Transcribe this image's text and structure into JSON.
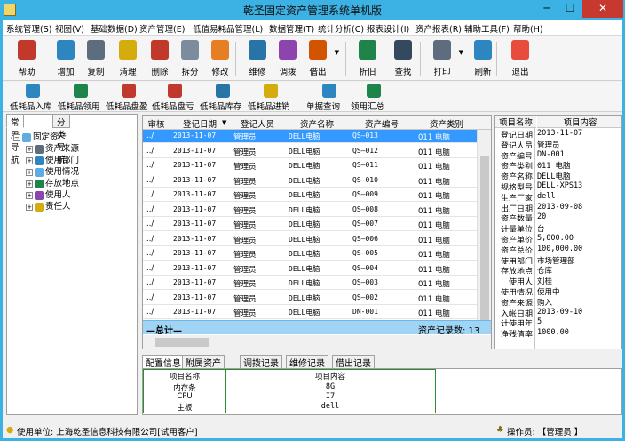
{
  "window": {
    "title": "乾圣固定资产管理系统单机版",
    "minimize": "─",
    "maximize": "☐",
    "close": "✕"
  },
  "menu": [
    "系统管理(S)",
    "视图(V)",
    "基础数据(D)",
    "资产管理(E)",
    "低值易耗品管理(L)",
    "数据管理(T)",
    "统计分析(C)",
    "报表设计(I)",
    "资产报表(R)",
    "辅助工具(F)",
    "帮助(H)"
  ],
  "toolbar": [
    {
      "label": "帮助",
      "icon": "help-icon",
      "color": "#c0392b"
    },
    {
      "label": "增加",
      "icon": "add-icon",
      "color": "#2e86c1"
    },
    {
      "label": "复制",
      "icon": "copy-icon",
      "color": "#5d6d7e"
    },
    {
      "label": "清理",
      "icon": "clear-icon",
      "color": "#d4ac0d"
    },
    {
      "label": "删除",
      "icon": "delete-icon",
      "color": "#c0392b"
    },
    {
      "label": "拆分",
      "icon": "split-icon",
      "color": "#7d8c9c"
    },
    {
      "label": "修改",
      "icon": "edit-icon",
      "color": "#e67e22"
    },
    {
      "label": "维修",
      "icon": "repair-icon",
      "color": "#2874a6"
    },
    {
      "label": "调拨",
      "icon": "transfer-icon",
      "color": "#8e44ad"
    },
    {
      "label": "借出",
      "icon": "lend-icon",
      "color": "#d35400"
    },
    {
      "label": "折旧",
      "icon": "depreciation-icon",
      "color": "#1e8449"
    },
    {
      "label": "查找",
      "icon": "find-icon",
      "color": "#34495e"
    },
    {
      "label": "打印",
      "icon": "print-icon",
      "color": "#5d6d7e"
    },
    {
      "label": "刷新",
      "icon": "refresh-icon",
      "color": "#2e86c1"
    },
    {
      "label": "退出",
      "icon": "exit-icon",
      "color": "#e74c3c"
    }
  ],
  "toolbar2": [
    {
      "label": "低耗品入库",
      "icon": "lv-stockin-icon",
      "color": "#2e86c1"
    },
    {
      "label": "低耗品领用",
      "icon": "lv-use-icon",
      "color": "#1e8449"
    },
    {
      "label": "低耗品盘盈",
      "icon": "lv-surplus-icon",
      "color": "#c0392b"
    },
    {
      "label": "低耗品盘亏",
      "icon": "lv-deficit-icon",
      "color": "#c0392b"
    },
    {
      "label": "低耗品库存",
      "icon": "lv-inventory-icon",
      "color": "#2874a6"
    },
    {
      "label": "低耗品进销",
      "icon": "lv-purchase-sales-icon",
      "color": "#d4ac0d"
    },
    {
      "label": "单据查询",
      "icon": "doc-query-icon",
      "color": "#2e86c1"
    },
    {
      "label": "领用汇总",
      "icon": "use-summary-icon",
      "color": "#1e8449"
    }
  ],
  "left_tabs": [
    "常用导航",
    "分类导航"
  ],
  "tree": {
    "root": "固定资产",
    "children": [
      "资产来源",
      "使用部门",
      "使用情况",
      "存放地点",
      "使用人",
      "责任人"
    ]
  },
  "grid": {
    "columns": [
      "审核",
      "登记日期",
      "登记人员",
      "资产名称",
      "资产编号",
      "资产类别"
    ],
    "rows": [
      [
        "../",
        "2013-11-07",
        "管理员",
        "DELL电脑",
        "QS—013",
        "011 电脑"
      ],
      [
        "../",
        "2013-11-07",
        "管理员",
        "DELL电脑",
        "QS—012",
        "011 电脑"
      ],
      [
        "../",
        "2013-11-07",
        "管理员",
        "DELL电脑",
        "QS—011",
        "011 电脑"
      ],
      [
        "../",
        "2013-11-07",
        "管理员",
        "DELL电脑",
        "QS—010",
        "011 电脑"
      ],
      [
        "../",
        "2013-11-07",
        "管理员",
        "DELL电脑",
        "QS—009",
        "011 电脑"
      ],
      [
        "../",
        "2013-11-07",
        "管理员",
        "DELL电脑",
        "QS—008",
        "011 电脑"
      ],
      [
        "../",
        "2013-11-07",
        "管理员",
        "DELL电脑",
        "QS—007",
        "011 电脑"
      ],
      [
        "../",
        "2013-11-07",
        "管理员",
        "DELL电脑",
        "QS—006",
        "011 电脑"
      ],
      [
        "../",
        "2013-11-07",
        "管理员",
        "DELL电脑",
        "QS—005",
        "011 电脑"
      ],
      [
        "../",
        "2013-11-07",
        "管理员",
        "DELL电脑",
        "QS—004",
        "011 电脑"
      ],
      [
        "../",
        "2013-11-07",
        "管理员",
        "DELL电脑",
        "QS—003",
        "011 电脑"
      ],
      [
        "../",
        "2013-11-07",
        "管理员",
        "DELL电脑",
        "QS—002",
        "011 电脑"
      ],
      [
        "../",
        "2013-11-07",
        "管理员",
        "DELL电脑",
        "DN-001",
        "011 电脑"
      ]
    ],
    "total_label": "—总计—",
    "record_count": "资产记录数: 13"
  },
  "detail": {
    "headers": [
      "项目名称",
      "项目内容"
    ],
    "rows": [
      [
        "登记日期",
        "2013-11-07"
      ],
      [
        "登记人员",
        "管理员"
      ],
      [
        "资产编号",
        "DN-001"
      ],
      [
        "资产类别",
        "011 电脑"
      ],
      [
        "资产名称",
        "DELL电脑"
      ],
      [
        "规格型号",
        "DELL-XPS13"
      ],
      [
        "生产厂家",
        "dell"
      ],
      [
        "出厂日期",
        "2013-09-08"
      ],
      [
        "资产数量",
        "20"
      ],
      [
        "计量单位",
        "台"
      ],
      [
        "资产单价",
        "5,000.00"
      ],
      [
        "资产总价",
        "100,000.00"
      ],
      [
        "使用部门",
        "市场管理部"
      ],
      [
        "存放地点",
        "仓库"
      ],
      [
        "使用人",
        "刘桂"
      ],
      [
        "使用情况",
        "使用中"
      ],
      [
        "资产来源",
        "购入"
      ],
      [
        "入帐日期",
        "2013-09-10"
      ],
      [
        "计使用年",
        "5"
      ],
      [
        "净残值率",
        "1000.00"
      ]
    ]
  },
  "bottom_tabs": [
    "配置信息",
    "附属资产",
    "调拨记录",
    "维修记录",
    "借出记录"
  ],
  "config": {
    "headers": [
      "项目名称",
      "项目内容"
    ],
    "rows": [
      [
        "内存条",
        "8G"
      ],
      [
        "CPU",
        "I7"
      ],
      [
        "主板",
        "dell"
      ]
    ]
  },
  "status": {
    "company": "使用单位: 上海乾圣信息科技有限公司[试用客户]",
    "operator": "操作员: 【管理员 】"
  }
}
